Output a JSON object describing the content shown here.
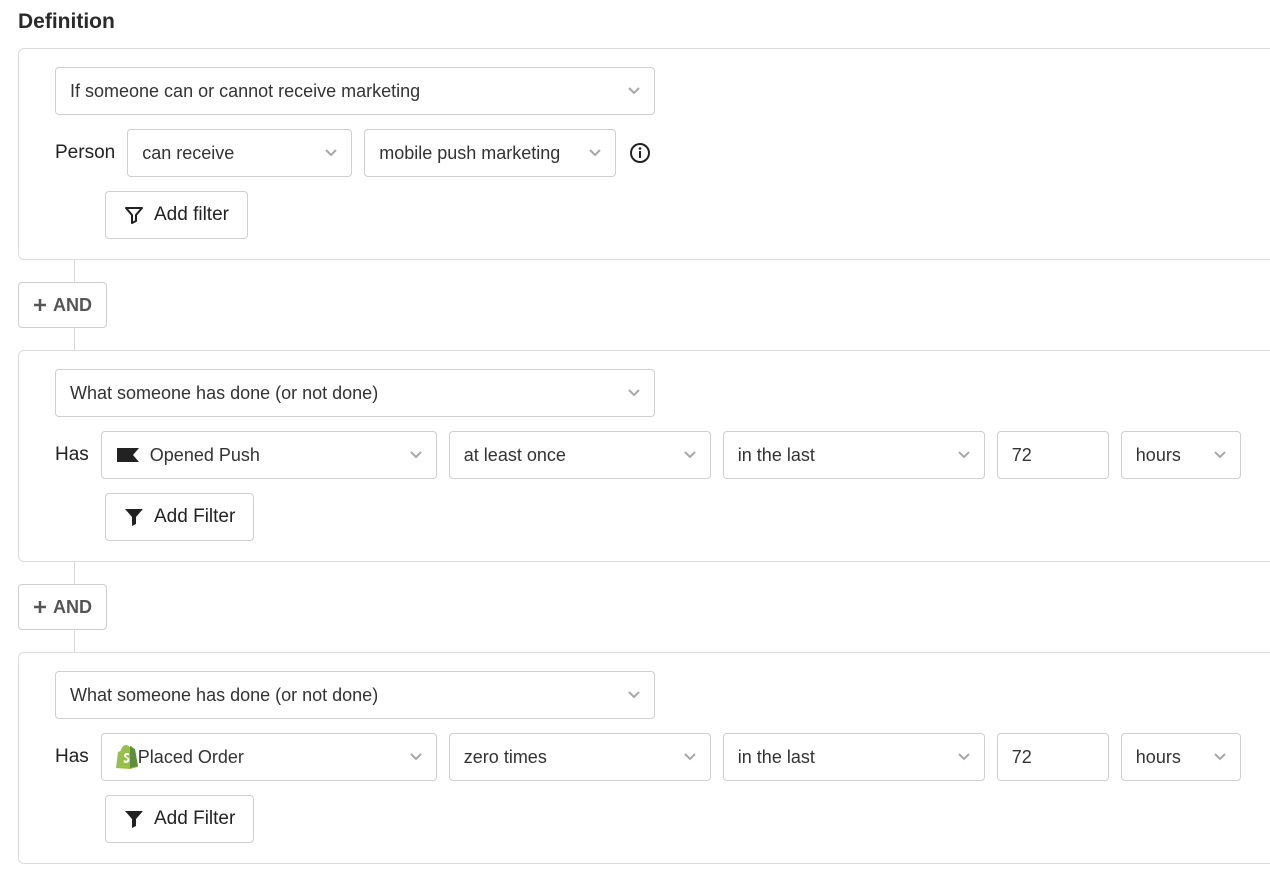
{
  "title": "Definition",
  "and_label": "AND",
  "blocks": [
    {
      "type_label": "If someone can or cannot receive marketing",
      "subject_label": "Person",
      "verb": "can receive",
      "channel": "mobile push marketing",
      "add_filter_label": "Add filter"
    },
    {
      "type_label": "What someone has done (or not done)",
      "subject_label": "Has",
      "event": "Opened Push",
      "frequency": "at least once",
      "range": "in the last",
      "value": "72",
      "unit": "hours",
      "add_filter_label": "Add Filter"
    },
    {
      "type_label": "What someone has done (or not done)",
      "subject_label": "Has",
      "event": "Placed Order",
      "frequency": "zero times",
      "range": "in the last",
      "value": "72",
      "unit": "hours",
      "add_filter_label": "Add Filter"
    }
  ]
}
